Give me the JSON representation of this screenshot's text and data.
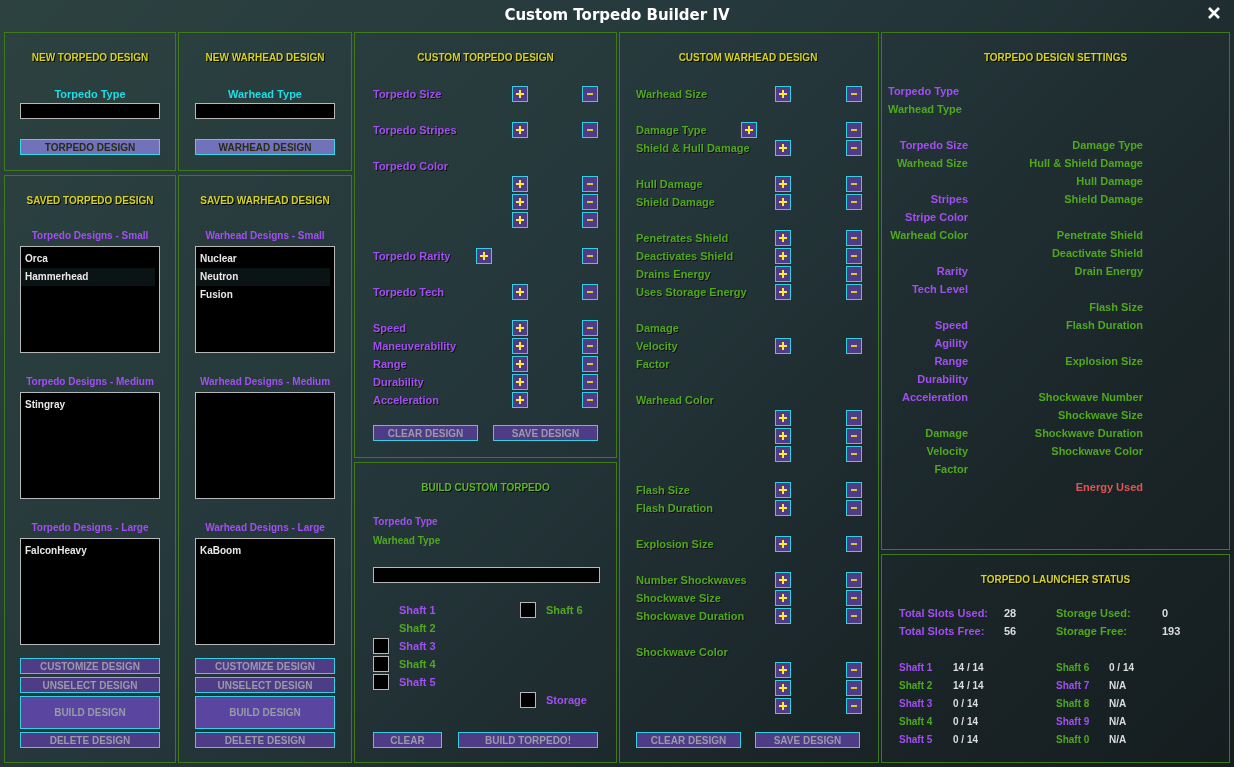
{
  "window": {
    "title": "Custom Torpedo Builder IV"
  },
  "new_torpedo": {
    "title": "NEW TORPEDO DESIGN",
    "label": "Torpedo Type",
    "button": "TORPEDO DESIGN"
  },
  "new_warhead": {
    "title": "NEW WARHEAD DESIGN",
    "label": "Warhead Type",
    "button": "WARHEAD DESIGN"
  },
  "saved_torpedo": {
    "title": "SAVED TORPEDO DESIGN",
    "lists": [
      {
        "header": "Torpedo Designs - Small",
        "items": [
          "Orca",
          "Hammerhead"
        ]
      },
      {
        "header": "Torpedo Designs - Medium",
        "items": [
          "Stingray"
        ]
      },
      {
        "header": "Torpedo Designs - Large",
        "items": [
          "FalconHeavy"
        ]
      }
    ],
    "buttons": [
      {
        "label": "CUSTOMIZE DESIGN",
        "kind": "normal"
      },
      {
        "label": "UNSELECT DESIGN",
        "kind": "normal"
      },
      {
        "label": "BUILD DESIGN",
        "kind": "tall"
      },
      {
        "label": "DELETE DESIGN",
        "kind": "normal"
      }
    ]
  },
  "saved_warhead": {
    "title": "SAVED WARHEAD DESIGN",
    "lists": [
      {
        "header": "Warhead Designs - Small",
        "items": [
          "Nuclear",
          "Neutron",
          "Fusion"
        ]
      },
      {
        "header": "Warhead Designs - Medium"
      },
      {
        "header": "Warhead Designs - Large",
        "items": [
          "KaBoom"
        ]
      }
    ],
    "buttons": [
      {
        "label": "CUSTOMIZE DESIGN",
        "kind": "normal"
      },
      {
        "label": "UNSELECT DESIGN",
        "kind": "normal"
      },
      {
        "label": "BUILD DESIGN",
        "kind": "tall"
      },
      {
        "label": "DELETE DESIGN",
        "kind": "normal"
      }
    ]
  },
  "custom_torpedo": {
    "title": "CUSTOM TORPEDO DESIGN",
    "kind": "torpedo",
    "groups": [
      [
        {
          "label": "Torpedo Size",
          "kind": "stepper"
        }
      ],
      [
        {
          "label": "Torpedo Stripes",
          "kind": "stepper"
        }
      ],
      [
        {
          "label": "Torpedo Color",
          "kind": "label"
        },
        {
          "kind": "stepper"
        },
        {
          "kind": "stepper"
        },
        {
          "kind": "stepper"
        }
      ],
      [
        {
          "label": "Torpedo Rarity",
          "kind": "inline"
        }
      ],
      [
        {
          "label": "Torpedo Tech",
          "kind": "stepper"
        }
      ],
      [
        {
          "label": "Speed",
          "kind": "stepper"
        },
        {
          "label": "Maneuverability",
          "kind": "stepper"
        },
        {
          "label": "Range",
          "kind": "stepper"
        },
        {
          "label": "Durability",
          "kind": "stepper"
        },
        {
          "label": "Acceleration",
          "kind": "stepper"
        }
      ]
    ],
    "buttons": [
      "CLEAR DESIGN",
      "SAVE DESIGN"
    ]
  },
  "build": {
    "title": "BUILD CUSTOM TORPEDO",
    "labels": [
      {
        "text": "Torpedo Type",
        "kind": "torpedo"
      },
      {
        "text": "Warhead Type",
        "kind": "warhead"
      }
    ],
    "left_shafts": [
      {
        "label": "Shaft 1",
        "kind": "torpedo"
      },
      {
        "label": "Shaft 2",
        "kind": "warhead"
      },
      {
        "label": "Shaft 3",
        "kind": "torpedo",
        "checked": false
      },
      {
        "label": "Shaft 4",
        "kind": "warhead",
        "checked": false
      },
      {
        "label": "Shaft 5",
        "kind": "torpedo",
        "checked": false
      }
    ],
    "right_shafts": [
      {
        "label": "Shaft 6",
        "kind": "warhead",
        "checked": false
      }
    ],
    "storage": {
      "label": "Storage",
      "kind": "torpedo",
      "checked": false
    },
    "buttons": [
      "CLEAR",
      "BUILD TORPEDO!"
    ]
  },
  "custom_warhead": {
    "title": "CUSTOM WARHEAD DESIGN",
    "kind": "warhead",
    "groups": [
      [
        {
          "label": "Warhead Size",
          "kind": "stepper"
        }
      ],
      [
        {
          "label": "Damage Type",
          "kind": "inline"
        },
        {
          "label": "Shield & Hull Damage",
          "kind": "stepper"
        }
      ],
      [
        {
          "label": "Hull Damage",
          "kind": "stepper"
        },
        {
          "label": "Shield Damage",
          "kind": "stepper"
        }
      ],
      [
        {
          "label": "Penetrates Shield",
          "kind": "stepper"
        },
        {
          "label": "Deactivates Shield",
          "kind": "stepper"
        },
        {
          "label": "Drains Energy",
          "kind": "stepper"
        },
        {
          "label": "Uses Storage Energy",
          "kind": "stepper"
        }
      ],
      [
        {
          "label": "Damage",
          "kind": "label"
        },
        {
          "label": "Velocity",
          "kind": "stepper"
        },
        {
          "label": "Factor",
          "kind": "label"
        }
      ],
      [
        {
          "label": "Warhead Color",
          "kind": "label"
        },
        {
          "kind": "stepper"
        },
        {
          "kind": "stepper"
        },
        {
          "kind": "stepper"
        }
      ],
      [
        {
          "label": "Flash Size",
          "kind": "stepper"
        },
        {
          "label": "Flash Duration",
          "kind": "stepper"
        }
      ],
      [
        {
          "label": "Explosion Size",
          "kind": "stepper"
        }
      ],
      [
        {
          "label": "Number Shockwaves",
          "kind": "stepper"
        },
        {
          "label": "Shockwave Size",
          "kind": "stepper"
        },
        {
          "label": "Shockwave Duration",
          "kind": "stepper"
        }
      ],
      [
        {
          "label": "Shockwave Color",
          "kind": "label"
        },
        {
          "kind": "stepper"
        },
        {
          "kind": "stepper"
        },
        {
          "kind": "stepper"
        }
      ]
    ],
    "buttons": [
      "CLEAR DESIGN",
      "SAVE DESIGN"
    ]
  },
  "settings": {
    "title": "TORPEDO DESIGN SETTINGS",
    "type_labels": [
      {
        "text": "Torpedo Type",
        "kind": "torpedo"
      },
      {
        "text": "Warhead Type",
        "kind": "warhead"
      }
    ],
    "rows": [
      {
        "left": {
          "text": "Torpedo Size",
          "kind": "torpedo"
        },
        "right": {
          "text": "Damage Type",
          "kind": "warhead"
        }
      },
      {
        "left": {
          "text": "Warhead Size",
          "kind": "warhead"
        },
        "right": {
          "text": "Hull & Shield Damage",
          "kind": "warhead"
        }
      },
      {
        "right": {
          "text": "Hull Damage",
          "kind": "warhead"
        }
      },
      {
        "left": {
          "text": "Stripes",
          "kind": "torpedo"
        },
        "right": {
          "text": "Shield Damage",
          "kind": "warhead"
        }
      },
      {
        "left": {
          "text": "Stripe Color",
          "kind": "torpedo"
        }
      },
      {
        "left": {
          "text": "Warhead Color",
          "kind": "warhead"
        },
        "right": {
          "text": "Penetrate Shield",
          "kind": "warhead"
        }
      },
      {
        "right": {
          "text": "Deactivate Shield",
          "kind": "warhead"
        }
      },
      {
        "left": {
          "text": "Rarity",
          "kind": "torpedo"
        },
        "right": {
          "text": "Drain Energy",
          "kind": "warhead"
        }
      },
      {
        "left": {
          "text": "Tech Level",
          "kind": "torpedo"
        }
      },
      {
        "right": {
          "text": "Flash Size",
          "kind": "warhead"
        }
      },
      {
        "left": {
          "text": "Speed",
          "kind": "torpedo"
        },
        "right": {
          "text": "Flash Duration",
          "kind": "warhead"
        }
      },
      {
        "left": {
          "text": "Agility",
          "kind": "torpedo"
        }
      },
      {
        "left": {
          "text": "Range",
          "kind": "torpedo"
        },
        "right": {
          "text": "Explosion Size",
          "kind": "warhead"
        }
      },
      {
        "left": {
          "text": "Durability",
          "kind": "torpedo"
        }
      },
      {
        "left": {
          "text": "Acceleration",
          "kind": "torpedo"
        },
        "right": {
          "text": "Shockwave Number",
          "kind": "warhead"
        }
      },
      {
        "right": {
          "text": "Shockwave Size",
          "kind": "warhead"
        }
      },
      {
        "left": {
          "text": "Damage",
          "kind": "warhead"
        },
        "right": {
          "text": "Shockwave Duration",
          "kind": "warhead"
        }
      },
      {
        "left": {
          "text": "Velocity",
          "kind": "warhead"
        },
        "right": {
          "text": "Shockwave Color",
          "kind": "warhead"
        }
      },
      {
        "left": {
          "text": "Factor",
          "kind": "warhead"
        }
      },
      {
        "right": {
          "text": "Energy Used",
          "kind": "energy"
        }
      }
    ]
  },
  "launcher": {
    "title": "TORPEDO LAUNCHER STATUS",
    "summary": [
      {
        "label": "Total Slots Used:",
        "value": "28",
        "kind": "torpedo"
      },
      {
        "label": "Storage Used:",
        "value": "0",
        "kind": "warhead"
      },
      {
        "label": "Total Slots Free:",
        "value": "56",
        "kind": "torpedo"
      },
      {
        "label": "Storage Free:",
        "value": "193",
        "kind": "warhead"
      }
    ],
    "shafts": [
      {
        "label": "Shaft 1",
        "value": "14 / 14",
        "kind": "torpedo"
      },
      {
        "label": "Shaft 6",
        "value": "0 / 14",
        "kind": "warhead"
      },
      {
        "label": "Shaft 2",
        "value": "14 / 14",
        "kind": "warhead"
      },
      {
        "label": "Shaft 7",
        "value": "N/A",
        "kind": "torpedo"
      },
      {
        "label": "Shaft 3",
        "value": "0 / 14",
        "kind": "torpedo"
      },
      {
        "label": "Shaft 8",
        "value": "N/A",
        "kind": "warhead"
      },
      {
        "label": "Shaft 4",
        "value": "0 / 14",
        "kind": "warhead"
      },
      {
        "label": "Shaft 9",
        "value": "N/A",
        "kind": "torpedo"
      },
      {
        "label": "Shaft 5",
        "value": "0 / 14",
        "kind": "torpedo"
      },
      {
        "label": "Shaft 0",
        "value": "N/A",
        "kind": "warhead"
      }
    ]
  }
}
